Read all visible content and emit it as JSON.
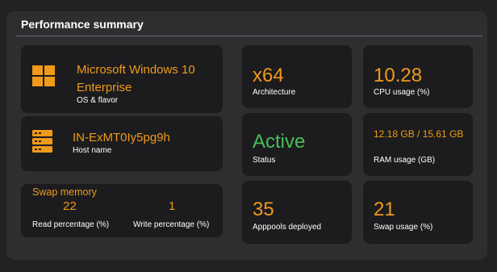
{
  "panel": {
    "title": "Performance summary"
  },
  "os": {
    "name": "Microsoft Windows 10 Enterprise",
    "label": "OS & flavor"
  },
  "host": {
    "name": "IN-ExMT0Iy5pg9h",
    "label": "Host name"
  },
  "swap_memory": {
    "title": "Swap memory",
    "read_value": "22",
    "read_label": "Read percentage (%)",
    "write_value": "1",
    "write_label": "Write percentage (%)"
  },
  "stats": {
    "architecture": {
      "value": "x64",
      "label": "Architecture"
    },
    "cpu": {
      "value": "10.28",
      "label": "CPU usage (%)"
    },
    "status": {
      "value": "Active",
      "label": "Status"
    },
    "ram": {
      "value": "12.18 GB / 15.61 GB",
      "label": "RAM usage (GB)"
    },
    "apppools": {
      "value": "35",
      "label": "Apppools deployed"
    },
    "swap_usage": {
      "value": "21",
      "label": "Swap usage (%)"
    }
  },
  "colors": {
    "accent": "#f09a1a",
    "success": "#49be5a",
    "panel": "#2e2e31",
    "card": "#1c1c1e"
  },
  "icons": {
    "os": "windows-logo-icon",
    "host": "server-icon"
  }
}
